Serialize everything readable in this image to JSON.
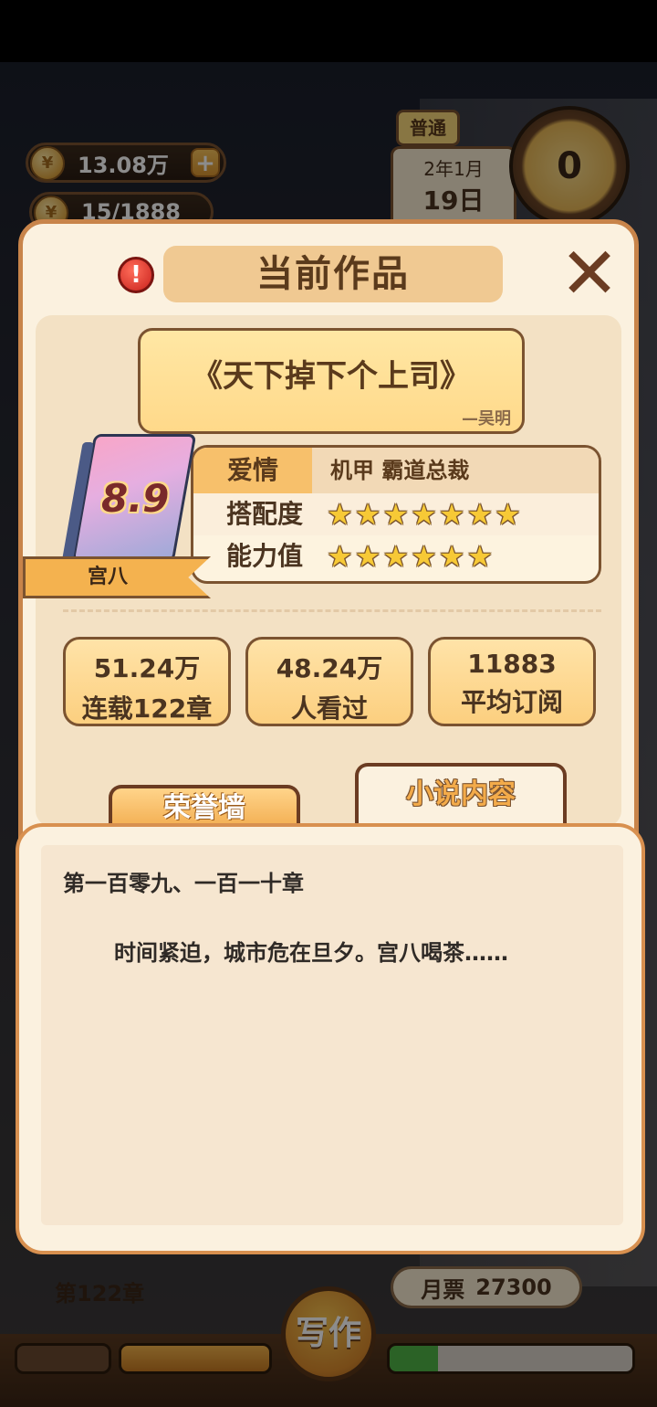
{
  "hud": {
    "coins": "13.08万",
    "energy": "15/1888",
    "mode": "普通",
    "month": "2年1月",
    "day": "19日",
    "timer": "0"
  },
  "bottom": {
    "chapter": "第122章",
    "ticket_label": "月票",
    "ticket_value": "27300",
    "write_label": "写作"
  },
  "modal": {
    "alert_icon": "!",
    "title": "当前作品",
    "close_icon": "✕",
    "book": {
      "name": "《天下掉下个上司》",
      "author": "—吴明",
      "score": "8.9",
      "protagonist": "宫八"
    },
    "genre": {
      "main": "爱情",
      "sub": "机甲  霸道总裁"
    },
    "ratings": [
      {
        "label": "搭配度",
        "stars": 7
      },
      {
        "label": "能力值",
        "stars": 6
      }
    ],
    "stats": [
      {
        "value": "51.24万",
        "label": "连载122章"
      },
      {
        "value": "48.24万",
        "label": "人看过"
      },
      {
        "value": "11883",
        "label": "平均订阅"
      }
    ],
    "tabs": {
      "honor": "荣誉墙",
      "content": "小说内容"
    },
    "content": {
      "chapter_range": "第一百零九、一百一十章",
      "excerpt": "时间紧迫，城市危在旦夕。宫八喝茶……"
    }
  }
}
